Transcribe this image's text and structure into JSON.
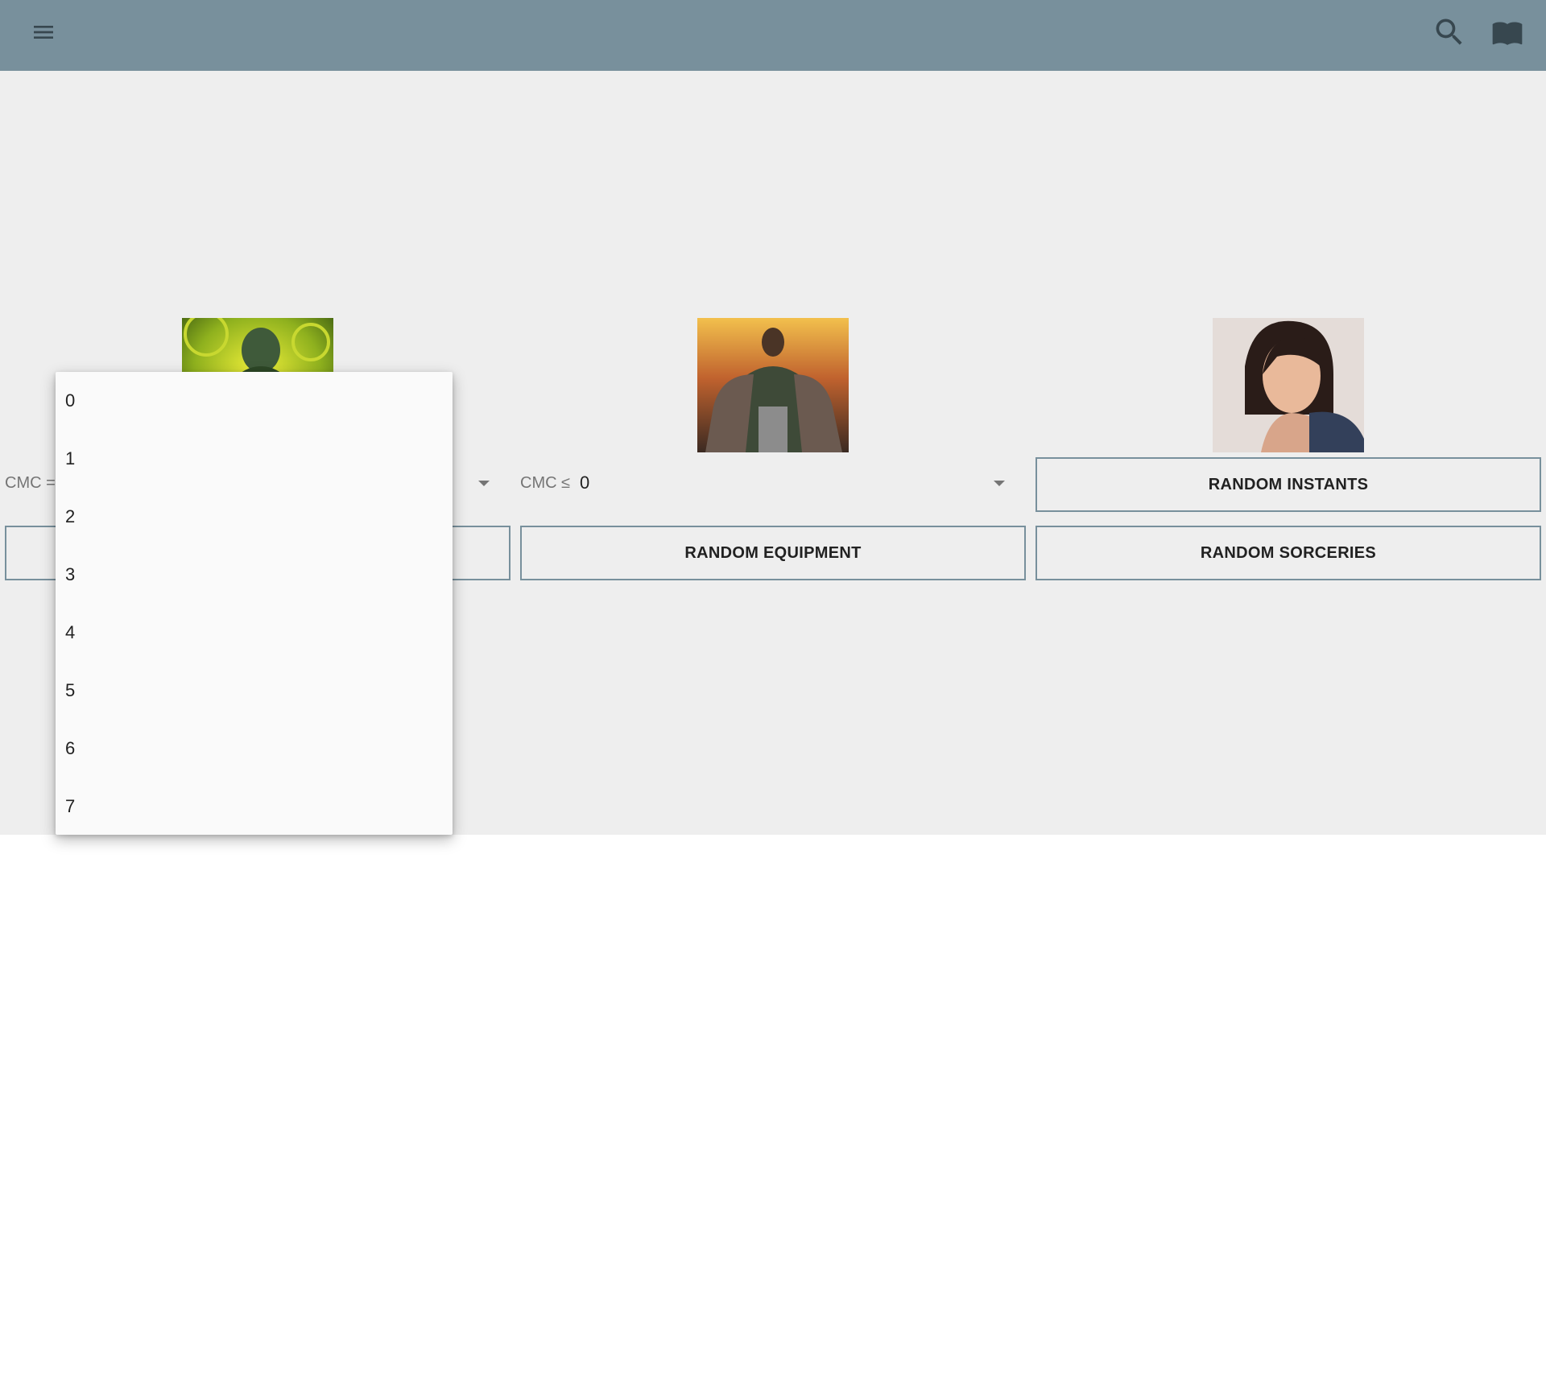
{
  "header": {
    "menu_icon": "menu-icon",
    "search_icon": "search-icon",
    "book_icon": "book-open-icon",
    "color": "#78909c"
  },
  "columns": [
    {
      "artwork": "goblin-creature-art",
      "select_prefix": "CMC =",
      "select_value": "",
      "buttons": [
        ""
      ]
    },
    {
      "artwork": "armored-warrior-art",
      "select_prefix": "CMC ≤",
      "select_value": "0",
      "buttons": [
        "RANDOM EQUIPMENT"
      ]
    },
    {
      "artwork": "woman-portrait-art",
      "buttons": [
        "RANDOM INSTANTS",
        "RANDOM SORCERIES"
      ]
    }
  ],
  "dropdown": {
    "options": [
      "0",
      "1",
      "2",
      "3",
      "4",
      "5",
      "6",
      "7"
    ]
  }
}
